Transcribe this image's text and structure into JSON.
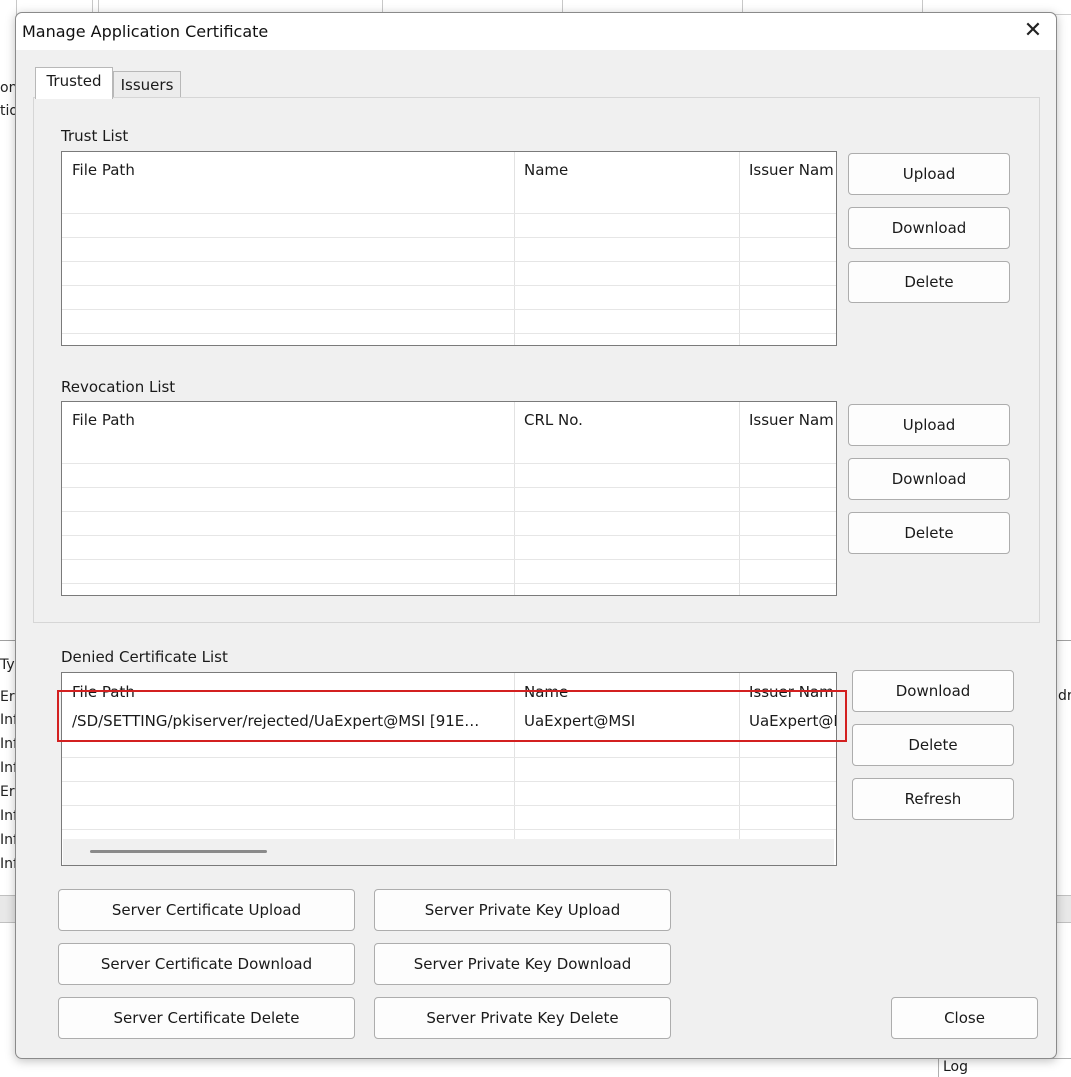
{
  "background": {
    "left_fragments": [
      "ons",
      "tio",
      "Typ",
      "Erro",
      "Info",
      "Info",
      "Info",
      "Erro",
      "Info",
      "Info",
      "Info"
    ],
    "right_fragment": "dre",
    "log_label": "Log"
  },
  "dialog": {
    "title": "Manage Application Certificate",
    "close_glyph": "✕",
    "tabs": [
      {
        "label": "Trusted",
        "active": true
      },
      {
        "label": "Issuers",
        "active": false
      }
    ],
    "trust_list": {
      "label": "Trust List",
      "columns": [
        "File Path",
        "Name",
        "Issuer Nam"
      ],
      "rows": [],
      "buttons": [
        "Upload",
        "Download",
        "Delete"
      ]
    },
    "revocation_list": {
      "label": "Revocation List",
      "columns": [
        "File Path",
        "CRL No.",
        "Issuer Nam"
      ],
      "rows": [],
      "buttons": [
        "Upload",
        "Download",
        "Delete"
      ]
    },
    "denied_list": {
      "label": "Denied Certificate List",
      "columns": [
        "File Path",
        "Name",
        "Issuer Nam"
      ],
      "rows": [
        {
          "file_path": "/SD/SETTING/pkiserver/rejected/UaExpert@MSI [91E…",
          "name": "UaExpert@MSI",
          "issuer": "UaExpert@I"
        }
      ],
      "buttons": [
        "Download",
        "Delete",
        "Refresh"
      ],
      "highlight_color": "#d32020"
    },
    "server_cert_buttons": [
      "Server Certificate Upload",
      "Server Certificate Download",
      "Server Certificate Delete"
    ],
    "server_key_buttons": [
      "Server Private Key Upload",
      "Server Private Key Download",
      "Server Private Key Delete"
    ],
    "close_label": "Close"
  }
}
